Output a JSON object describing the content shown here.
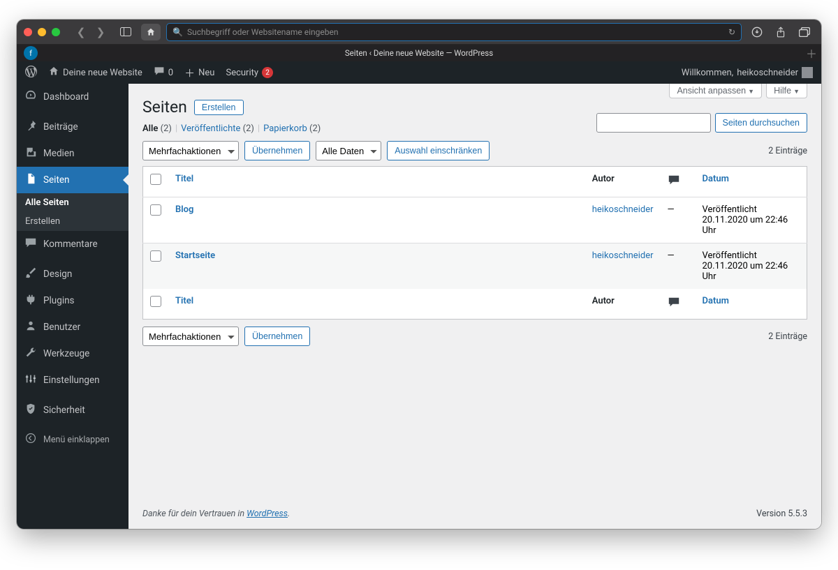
{
  "browser": {
    "url_placeholder": "Suchbegriff oder Websitename eingeben",
    "tab_title": "Seiten ‹ Deine neue Website — WordPress"
  },
  "adminbar": {
    "site_name": "Deine neue Website",
    "comments_count": "0",
    "new_label": "Neu",
    "security_label": "Security",
    "security_badge": "2",
    "welcome_prefix": "Willkommen, ",
    "welcome_user": "heikoschneider"
  },
  "sidebar": {
    "dashboard": "Dashboard",
    "posts": "Beiträge",
    "media": "Medien",
    "pages": "Seiten",
    "pages_sub_all": "Alle Seiten",
    "pages_sub_new": "Erstellen",
    "comments": "Kommentare",
    "appearance": "Design",
    "plugins": "Plugins",
    "users": "Benutzer",
    "tools": "Werkzeuge",
    "settings": "Einstellungen",
    "security": "Sicherheit",
    "collapse": "Menü einklappen"
  },
  "screen_meta": {
    "options": "Ansicht anpassen",
    "help": "Hilfe"
  },
  "page": {
    "title": "Seiten",
    "create": "Erstellen"
  },
  "filters": {
    "all_label": "Alle",
    "all_count": "(2)",
    "published_label": "Veröffentlichte",
    "published_count": "(2)",
    "trash_label": "Papierkorb",
    "trash_count": "(2)"
  },
  "search": {
    "button": "Seiten durchsuchen"
  },
  "bulk": {
    "action_label": "Mehrfachaktionen",
    "apply": "Übernehmen",
    "date_filter": "Alle Daten",
    "restrict": "Auswahl einschränken",
    "count_text": "2 Einträge"
  },
  "table": {
    "col_title": "Titel",
    "col_author": "Autor",
    "col_date": "Datum",
    "rows": [
      {
        "title": "Blog",
        "author": "heikoschneider",
        "comments": "—",
        "status": "Veröffentlicht",
        "datetime": "20.11.2020 um 22:46 Uhr"
      },
      {
        "title": "Startseite",
        "author": "heikoschneider",
        "comments": "—",
        "status": "Veröffentlicht",
        "datetime": "20.11.2020 um 22:46 Uhr"
      }
    ]
  },
  "footer": {
    "thanks_prefix": "Danke für dein Vertrauen in ",
    "wp_link": "WordPress",
    "version": "Version 5.5.3"
  }
}
